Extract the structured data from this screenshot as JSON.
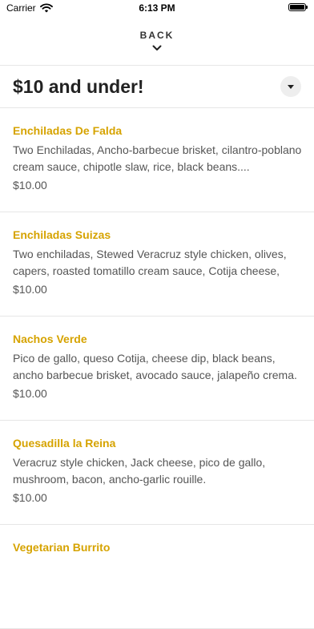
{
  "status_bar": {
    "carrier": "Carrier",
    "time": "6:13 PM"
  },
  "nav": {
    "back_label": "BACK"
  },
  "section": {
    "title": "$10 and under!"
  },
  "menu_items": [
    {
      "name": "Enchiladas De Falda",
      "description": "Two Enchiladas, Ancho-barbecue brisket, cilantro-poblano cream sauce, chipotle slaw, rice, black beans....",
      "price": "$10.00"
    },
    {
      "name": "Enchiladas Suizas",
      "description": "Two enchiladas, Stewed Veracruz style chicken, olives, capers, roasted tomatillo cream sauce, Cotija cheese, pic...",
      "price": "$10.00"
    },
    {
      "name": "Nachos Verde",
      "description": "Pico de gallo, queso Cotija, cheese dip, black beans, ancho barbecue brisket, avocado sauce, jalapeño crema.",
      "price": "$10.00"
    },
    {
      "name": "Quesadilla la Reina",
      "description": "Veracruz style chicken, Jack cheese, pico de gallo, mushroom, bacon, ancho-garlic rouille.",
      "price": "$10.00"
    },
    {
      "name": "Vegetarian Burrito",
      "description": "",
      "price": ""
    }
  ],
  "colors": {
    "item_name": "#d6a300",
    "description": "#555555",
    "divider": "#e6e6e6"
  },
  "icons": {
    "wifi": "wifi-icon",
    "battery": "battery-icon",
    "back_chevron": "chevron-down-icon",
    "dropdown": "caret-down-icon"
  }
}
